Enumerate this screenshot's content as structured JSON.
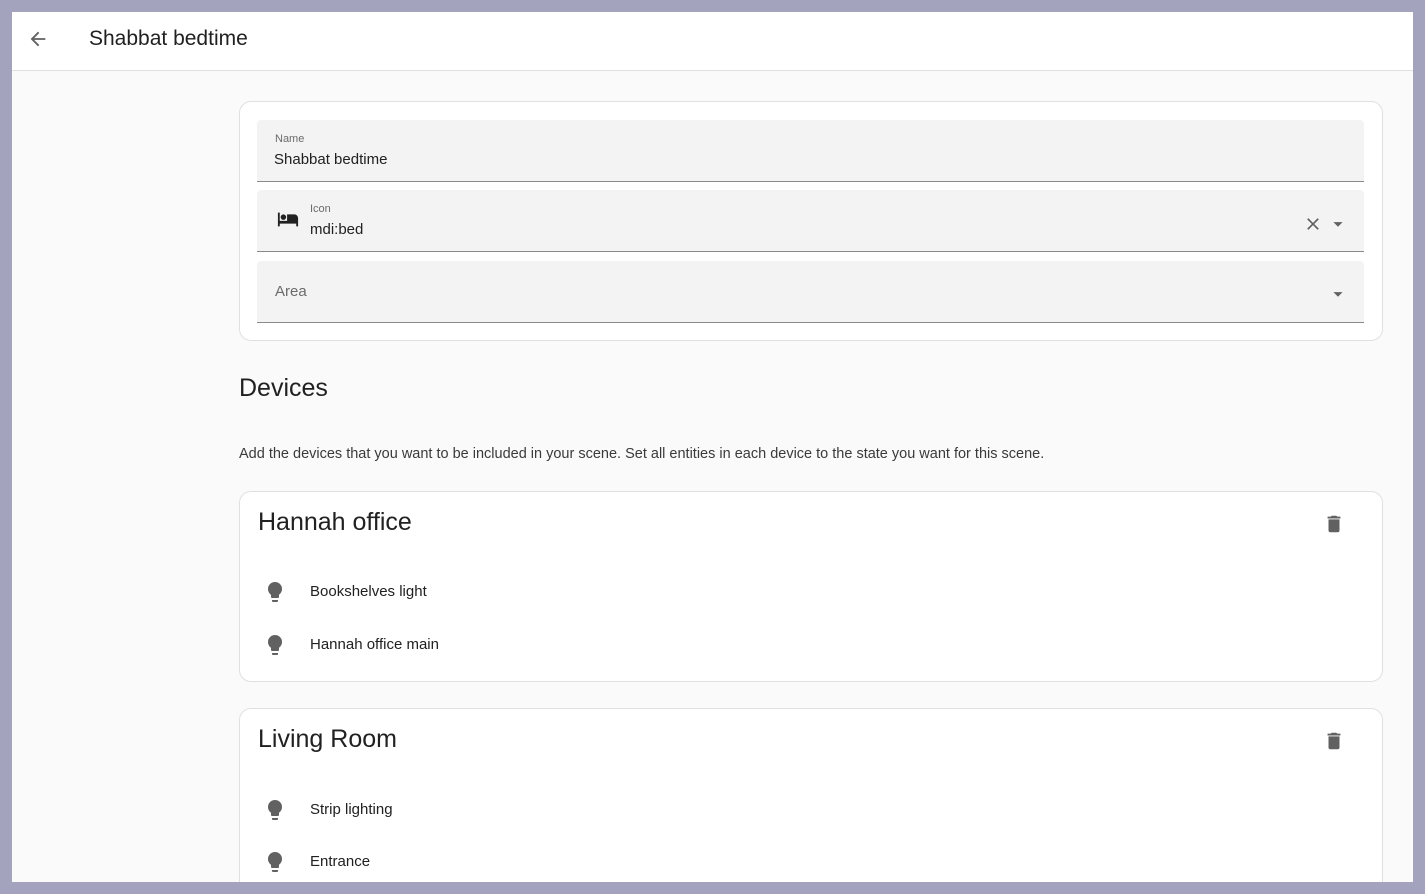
{
  "header": {
    "title": "Shabbat bedtime"
  },
  "form": {
    "name": {
      "label": "Name",
      "value": "Shabbat bedtime"
    },
    "icon": {
      "label": "Icon",
      "value": "mdi:bed",
      "icon": "bed-icon"
    },
    "area": {
      "label": "Area",
      "value": ""
    }
  },
  "devices_section": {
    "title": "Devices",
    "description": "Add the devices that you want to be included in your scene. Set all entities in each device to the state you want for this scene."
  },
  "devices": [
    {
      "name": "Hannah office",
      "entities": [
        {
          "label": "Bookshelves light",
          "icon": "lightbulb-icon"
        },
        {
          "label": "Hannah office main",
          "icon": "lightbulb-icon"
        }
      ]
    },
    {
      "name": "Living Room",
      "entities": [
        {
          "label": "Strip lighting",
          "icon": "lightbulb-icon"
        },
        {
          "label": "Entrance",
          "icon": "lightbulb-icon"
        }
      ]
    }
  ],
  "colors": {
    "outer_background": "#a3a3bd",
    "page_background": "#fafafa",
    "field_background": "#f3f3f3",
    "icon_color": "#616161"
  }
}
